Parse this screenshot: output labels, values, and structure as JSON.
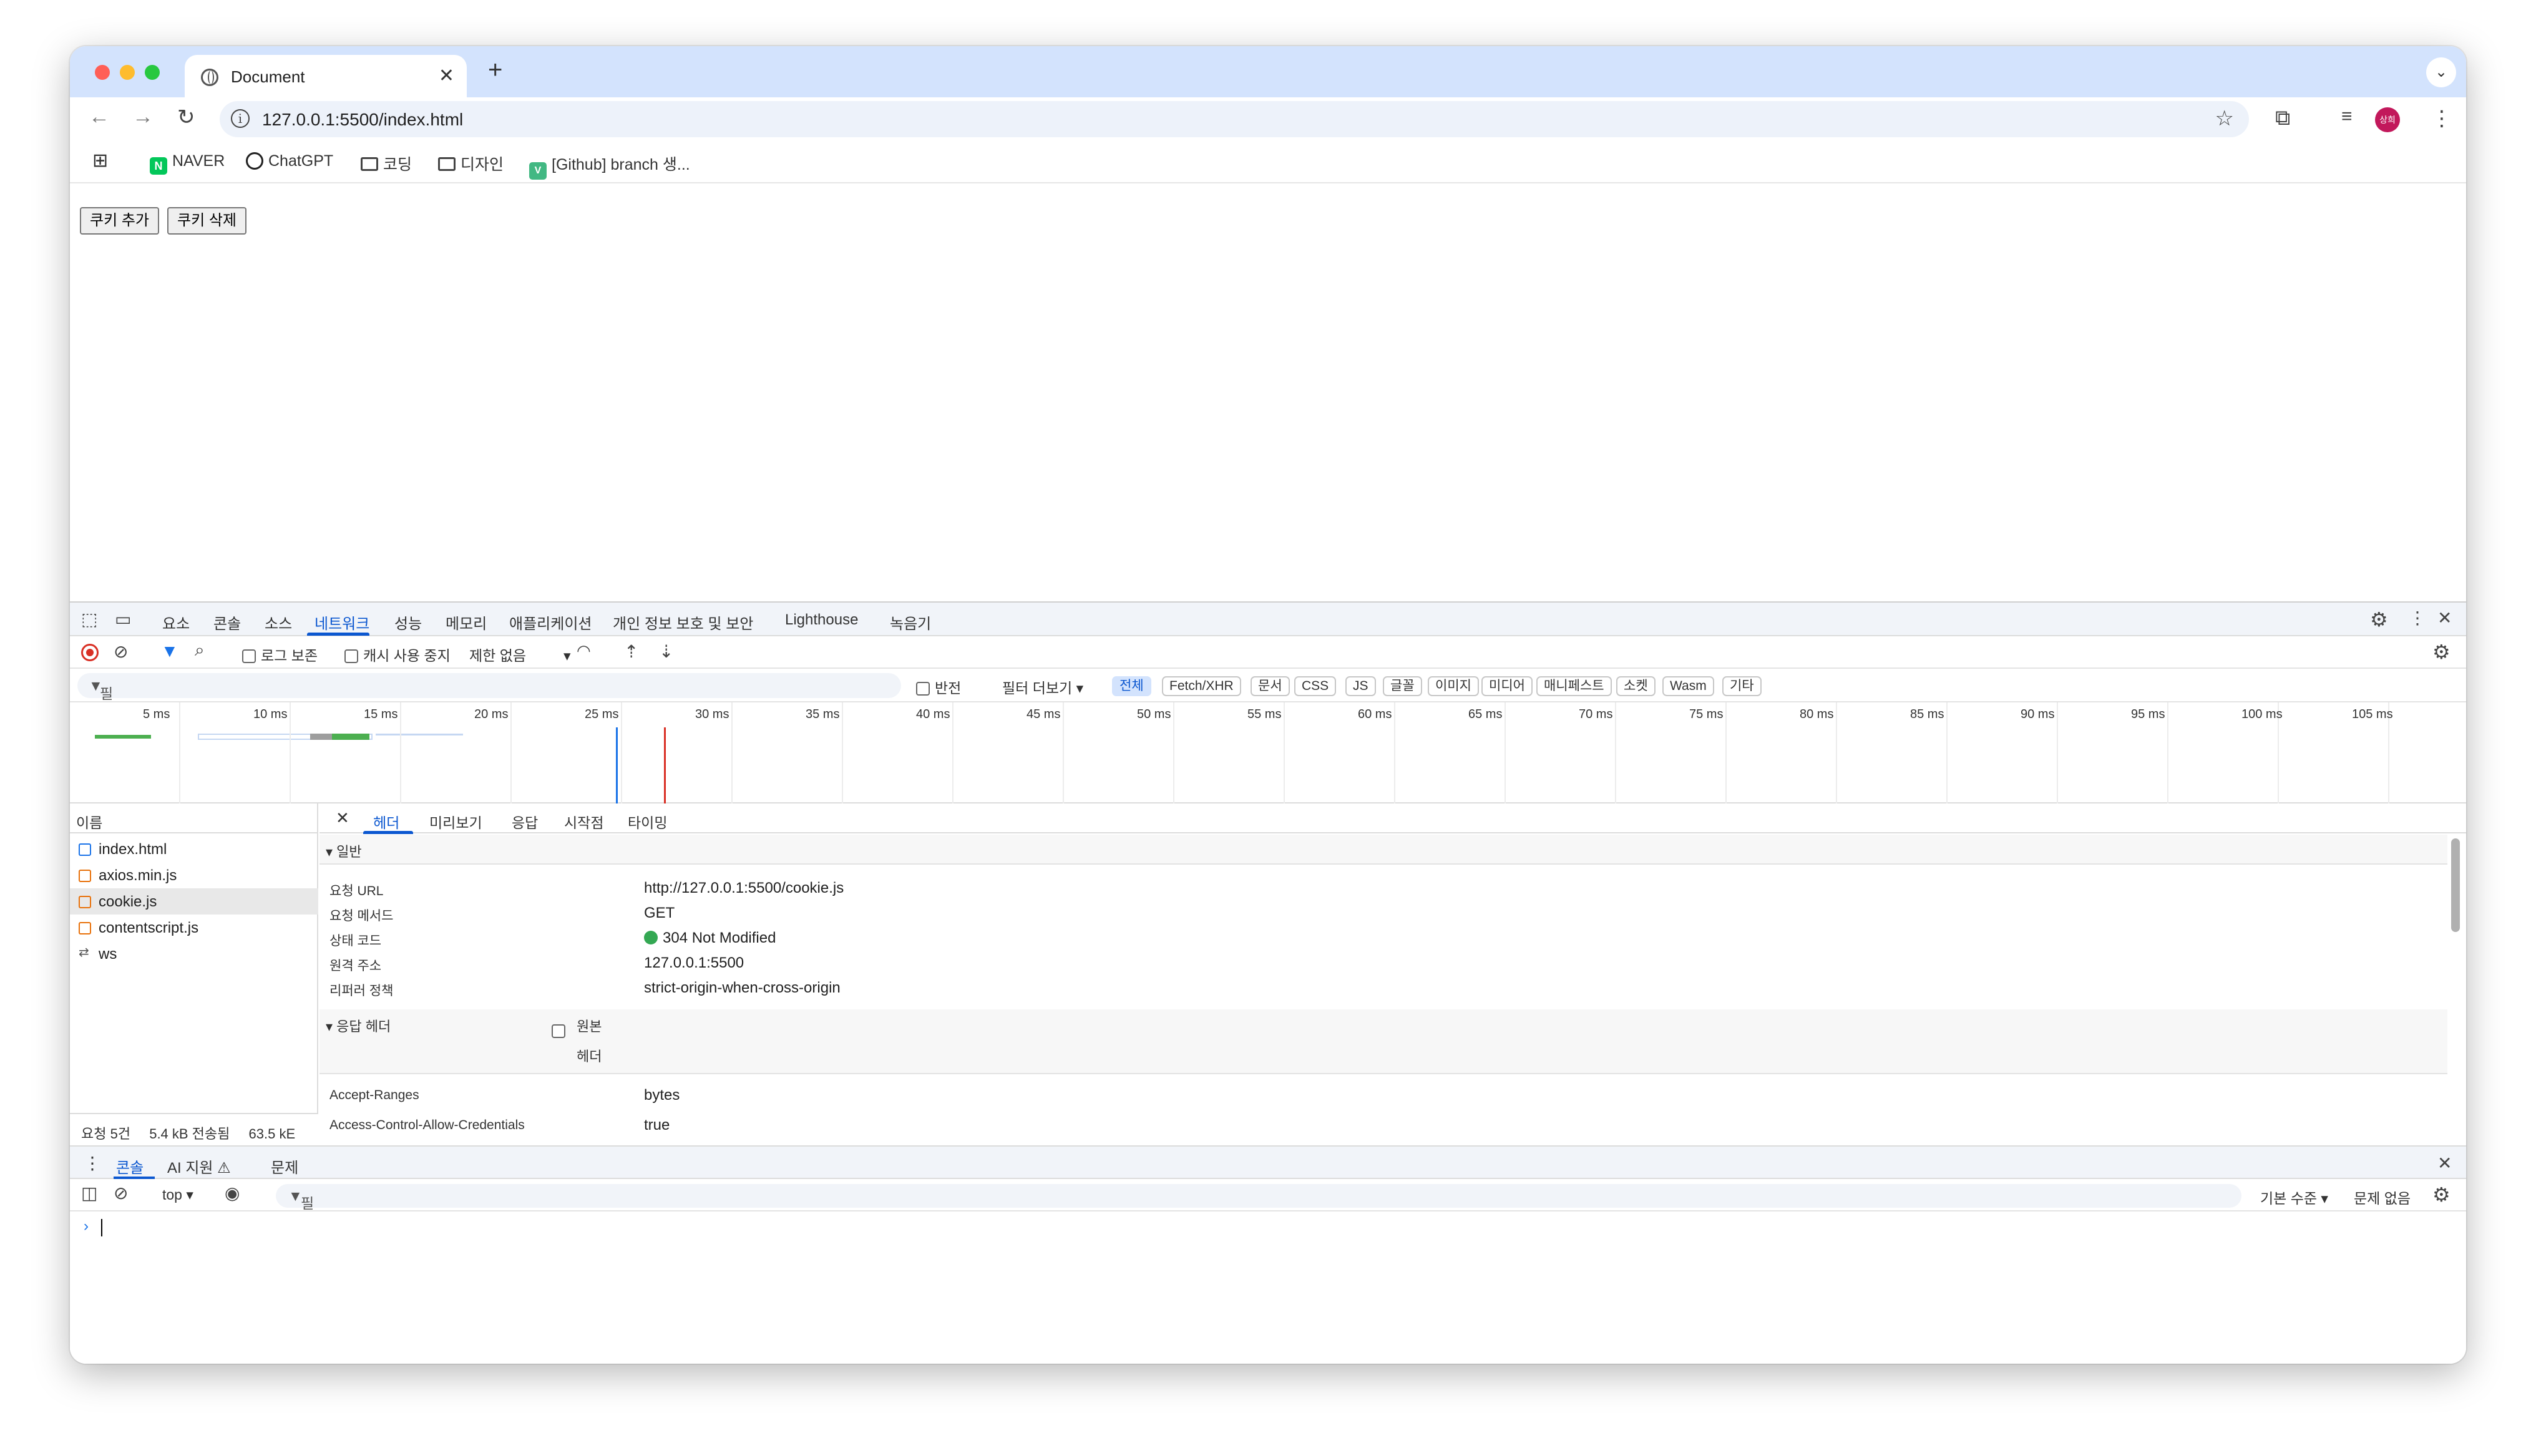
{
  "browser": {
    "tab_title": "Document",
    "new_tab": "+",
    "close_tab": "✕",
    "url": "127.0.0.1:5500/index.html",
    "profile_label": "상희",
    "bookmarks": [
      "NAVER",
      "ChatGPT",
      "코딩",
      "디자인",
      "[Github] branch 생..."
    ]
  },
  "page": {
    "buttons": [
      "쿠키 추가",
      "쿠키 삭제"
    ]
  },
  "devtools": {
    "main_tabs": [
      "요소",
      "콘솔",
      "소스",
      "네트워크",
      "성능",
      "메모리",
      "애플리케이션",
      "개인 정보 보호 및 보안",
      "Lighthouse",
      "녹음기"
    ],
    "active_tab": "네트워크",
    "network_toolbar": {
      "preserve_log": "로그 보존",
      "disable_cache": "캐시 사용 중지",
      "throttle": "제한 없음"
    },
    "filter": {
      "placeholder": "필터",
      "invert": "반전",
      "more_filters": "필터 더보기",
      "chips": [
        "전체",
        "Fetch/XHR",
        "문서",
        "CSS",
        "JS",
        "글꼴",
        "이미지",
        "미디어",
        "매니페스트",
        "소켓",
        "Wasm",
        "기타"
      ],
      "active_chip": "전체"
    },
    "timeline_ticks": [
      "5 ms",
      "10 ms",
      "15 ms",
      "20 ms",
      "25 ms",
      "30 ms",
      "35 ms",
      "40 ms",
      "45 ms",
      "50 ms",
      "55 ms",
      "60 ms",
      "65 ms",
      "70 ms",
      "75 ms",
      "80 ms",
      "85 ms",
      "90 ms",
      "95 ms",
      "100 ms",
      "105 ms"
    ],
    "request_list": {
      "header": "이름",
      "rows": [
        {
          "name": "index.html",
          "type": "doc"
        },
        {
          "name": "axios.min.js",
          "type": "js"
        },
        {
          "name": "cookie.js",
          "type": "js"
        },
        {
          "name": "contentscript.js",
          "type": "js"
        },
        {
          "name": "ws",
          "type": "ws"
        }
      ],
      "selected": "cookie.js"
    },
    "details": {
      "tabs": [
        "헤더",
        "미리보기",
        "응답",
        "시작점",
        "타이밍"
      ],
      "active_tab": "헤더",
      "general_title": "▾ 일반",
      "general": [
        {
          "key": "요청 URL",
          "value": "http://127.0.0.1:5500/cookie.js"
        },
        {
          "key": "요청 메서드",
          "value": "GET"
        },
        {
          "key": "상태 코드",
          "value": "304 Not Modified"
        },
        {
          "key": "원격 주소",
          "value": "127.0.0.1:5500"
        },
        {
          "key": "리퍼러 정책",
          "value": "strict-origin-when-cross-origin"
        }
      ],
      "response_title": "▾ 응답 헤더",
      "raw_label_1": "원본",
      "raw_label_2": "헤더",
      "response_headers": [
        {
          "key": "Accept-Ranges",
          "value": "bytes"
        },
        {
          "key": "Access-Control-Allow-Credentials",
          "value": "true"
        }
      ]
    },
    "summary": {
      "requests": "요청 5건",
      "transferred": "5.4 kB 전송됨",
      "resources": "63.5 kE"
    },
    "drawer": {
      "tabs": [
        "콘솔",
        "AI 지원 ⚠",
        "문제"
      ],
      "active_tab": "콘솔",
      "context": "top ▾",
      "filter_placeholder": "필터",
      "level": "기본 수준 ▾",
      "issues": "문제 없음"
    }
  },
  "colors": {
    "tabstrip": "#d3e3fd",
    "accent": "#0b57d0",
    "status_ok": "#34a853",
    "record": "#d93025"
  }
}
